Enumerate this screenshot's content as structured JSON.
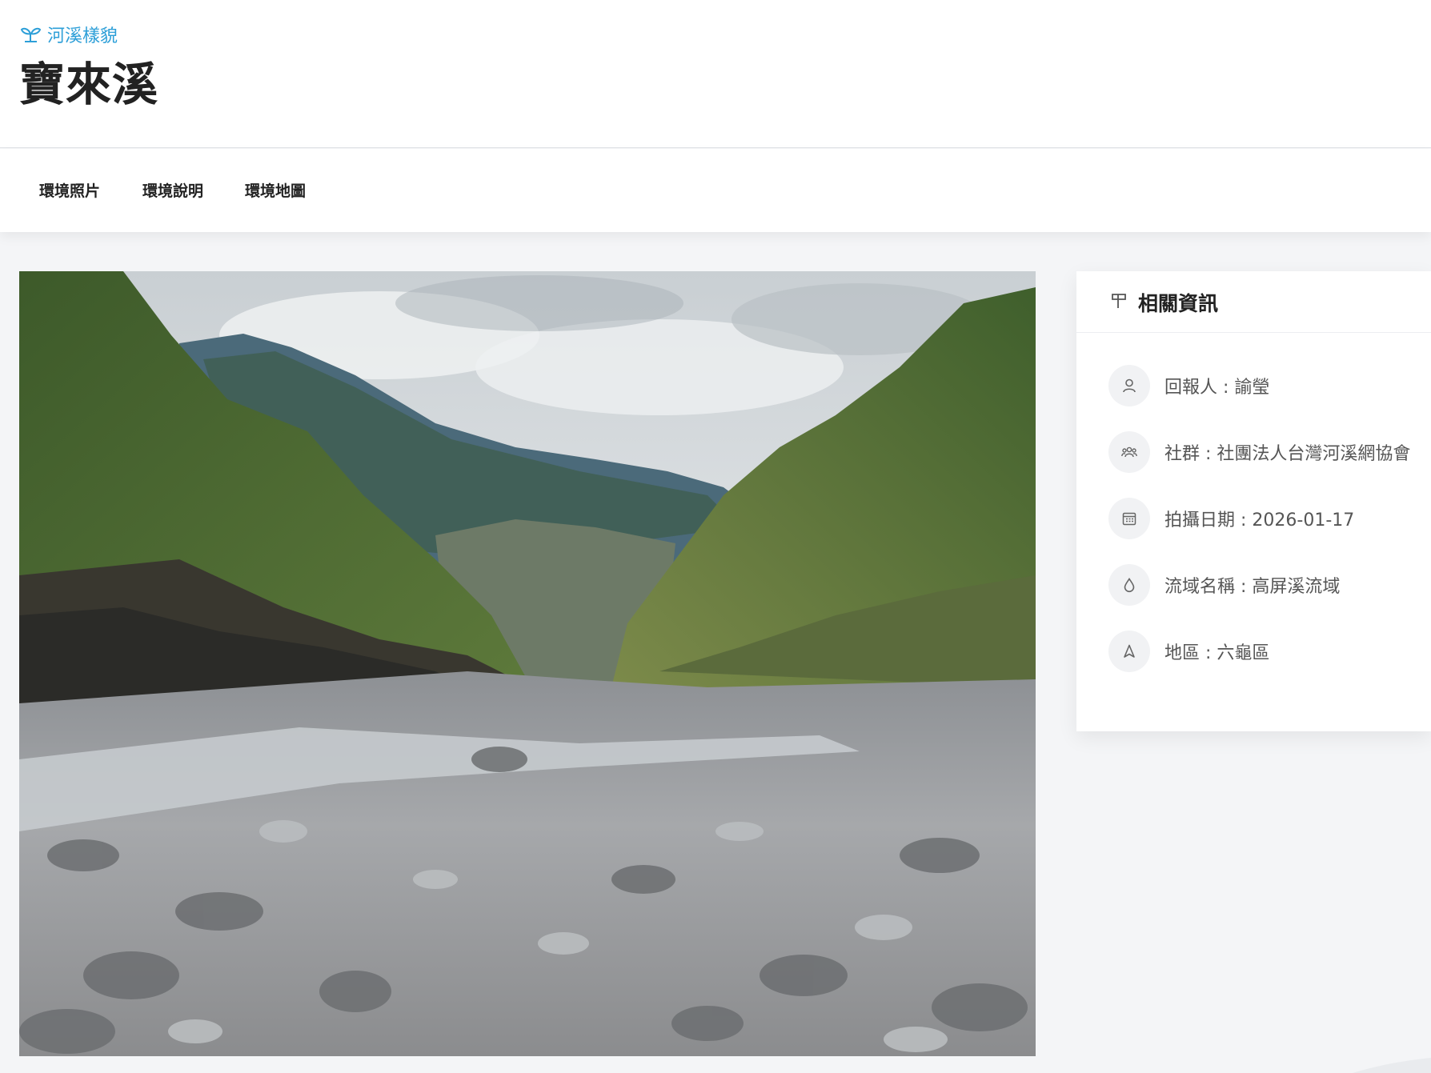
{
  "header": {
    "breadcrumb_label": "河溪樣貌",
    "breadcrumb_icon": "sprout-icon",
    "title": "寶來溪"
  },
  "tabs": [
    {
      "label": "環境照片"
    },
    {
      "label": "環境說明"
    },
    {
      "label": "環境地圖"
    }
  ],
  "photo": {
    "subject": "river-photo"
  },
  "info_panel": {
    "title": "相關資訊",
    "title_icon": "flag-icon",
    "items": [
      {
        "icon": "user-icon",
        "text": "回報人 : 諭瑩"
      },
      {
        "icon": "group-icon",
        "text": "社群 : 社團法人台灣河溪網協會"
      },
      {
        "icon": "calendar-icon",
        "text": "拍攝日期 : 2026-01-17"
      },
      {
        "icon": "water-drop-icon",
        "text": "流域名稱 : 高屏溪流域"
      },
      {
        "icon": "location-arrow-icon",
        "text": "地區 : 六龜區"
      }
    ]
  },
  "colors": {
    "accent": "#2d9fd8",
    "background": "#f4f5f7",
    "panel": "#ffffff"
  }
}
